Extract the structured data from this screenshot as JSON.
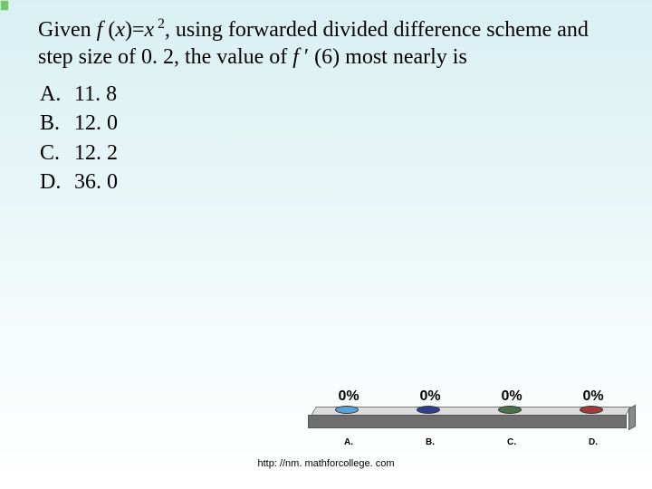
{
  "question": {
    "pre": "Given ",
    "fx1": "f ",
    "open": "(",
    "x": "x",
    "close": ")=",
    "var": "x",
    "sup": " 2",
    "mid": ", using forwarded divided difference scheme and step size of 0. 2, the value of ",
    "fx2": "f ",
    "prime": "′ (6) most nearly is"
  },
  "choices": [
    {
      "label": "A.",
      "value": "11. 8"
    },
    {
      "label": "B.",
      "value": "12. 0"
    },
    {
      "label": "C.",
      "value": "12. 2"
    },
    {
      "label": "D.",
      "value": "36. 0"
    }
  ],
  "chart_data": {
    "type": "bar",
    "categories": [
      "A.",
      "B.",
      "C.",
      "D."
    ],
    "values": [
      0,
      0,
      0,
      0
    ],
    "display_labels": [
      "0%",
      "0%",
      "0%",
      "0%"
    ],
    "title": "",
    "xlabel": "",
    "ylabel": "",
    "ylim": [
      0,
      100
    ]
  },
  "footer": "http: //nm. mathforcollege. com"
}
